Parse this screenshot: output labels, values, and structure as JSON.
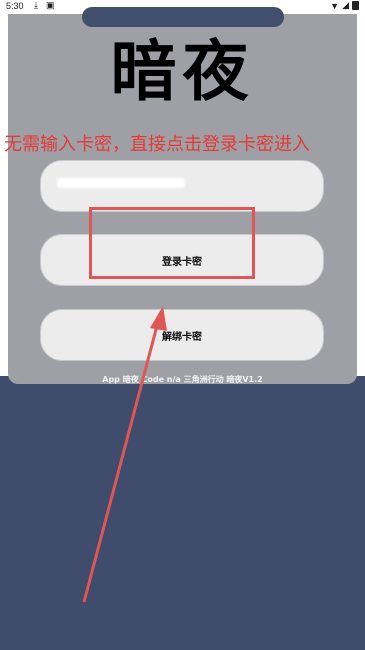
{
  "status_bar": {
    "time": "5:30"
  },
  "app": {
    "title": "暗夜",
    "annotation_text": "无需输入卡密，直接点击登录卡密进入",
    "login_button": "登录卡密",
    "unbind_button": "解绑卡密",
    "footer": "App 暗夜 Code n/a 三角洲行动 暗夜V1.2"
  },
  "colors": {
    "annotation": "#e53935",
    "dialog_bg": "#9fa0a6",
    "page_bg": "#3f4c6b"
  }
}
